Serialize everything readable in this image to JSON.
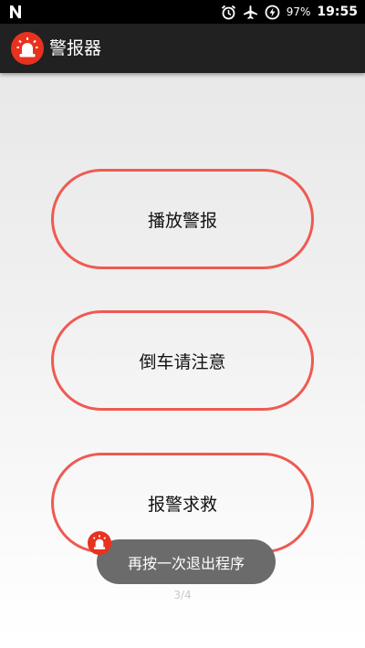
{
  "status_bar": {
    "left_icon": "n-notification-icon",
    "icons": [
      "alarm-icon",
      "airplane-mode-icon",
      "battery-charging-icon"
    ],
    "battery": "97%",
    "time": "19:55"
  },
  "app_bar": {
    "logo_icon": "siren-icon",
    "title": "警报器"
  },
  "buttons": [
    {
      "label": "播放警报"
    },
    {
      "label": "倒车请注意"
    },
    {
      "label": "报警求救"
    }
  ],
  "toast": {
    "icon": "siren-icon",
    "message": "再按一次退出程序"
  },
  "page_indicator": "3/4",
  "colors": {
    "accent": "#ef5a52",
    "logo_red": "#e8321e",
    "app_bar": "#212121",
    "toast_bg": "#6b6b6b"
  }
}
